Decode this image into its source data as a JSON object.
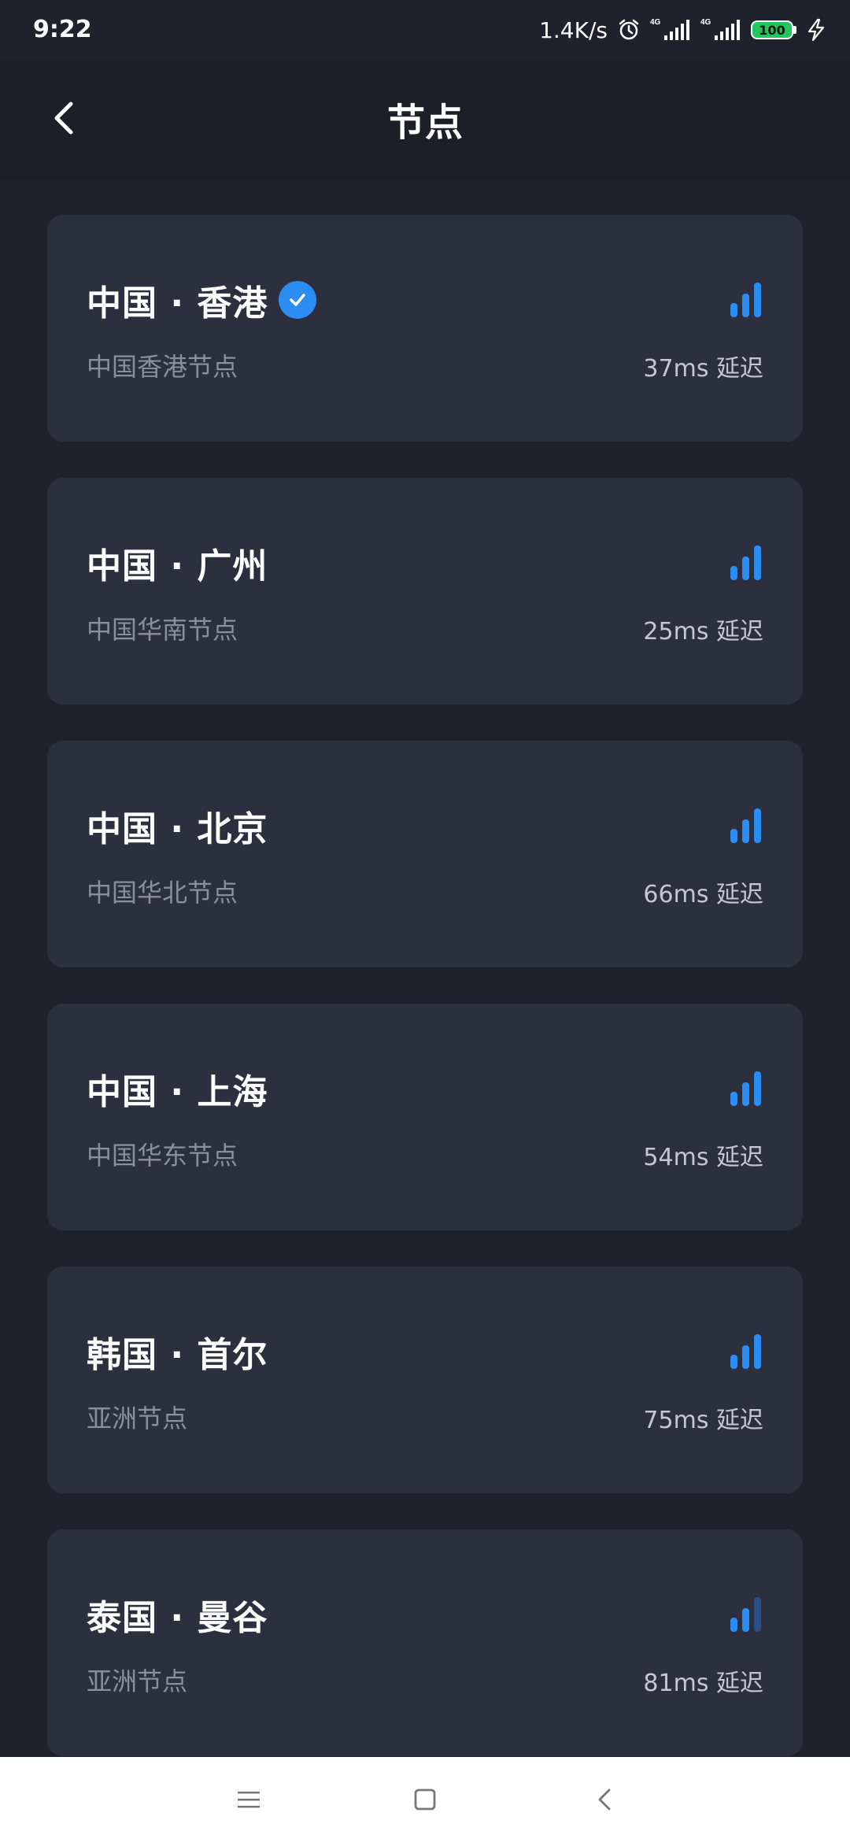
{
  "status_bar": {
    "time": "9:22",
    "net_speed": "1.4K/s",
    "network_type_1": "4G",
    "network_type_2": "4G",
    "battery": "100"
  },
  "header": {
    "title": "节点",
    "back_icon": "chevron-left-icon"
  },
  "colors": {
    "accent": "#2b8cf2",
    "background": "#1f222c",
    "card": "#2c2f3d",
    "signal_active": "#2b8cf2",
    "signal_inactive": "#2a4f80"
  },
  "nodes": [
    {
      "name": "中国 · 香港",
      "sub": "中国香港节点",
      "latency": "37ms 延迟",
      "selected": true,
      "signal_bars": 3
    },
    {
      "name": "中国 · 广州",
      "sub": "中国华南节点",
      "latency": "25ms 延迟",
      "selected": false,
      "signal_bars": 3
    },
    {
      "name": "中国 · 北京",
      "sub": "中国华北节点",
      "latency": "66ms 延迟",
      "selected": false,
      "signal_bars": 3
    },
    {
      "name": "中国 · 上海",
      "sub": "中国华东节点",
      "latency": "54ms 延迟",
      "selected": false,
      "signal_bars": 3
    },
    {
      "name": "韩国 · 首尔",
      "sub": "亚洲节点",
      "latency": "75ms 延迟",
      "selected": false,
      "signal_bars": 3
    },
    {
      "name": "泰国 · 曼谷",
      "sub": "亚洲节点",
      "latency": "81ms 延迟",
      "selected": false,
      "signal_bars": 2
    }
  ],
  "nav_bar": {
    "items": [
      "menu-icon",
      "home-square-icon",
      "back-triangle-icon"
    ]
  }
}
